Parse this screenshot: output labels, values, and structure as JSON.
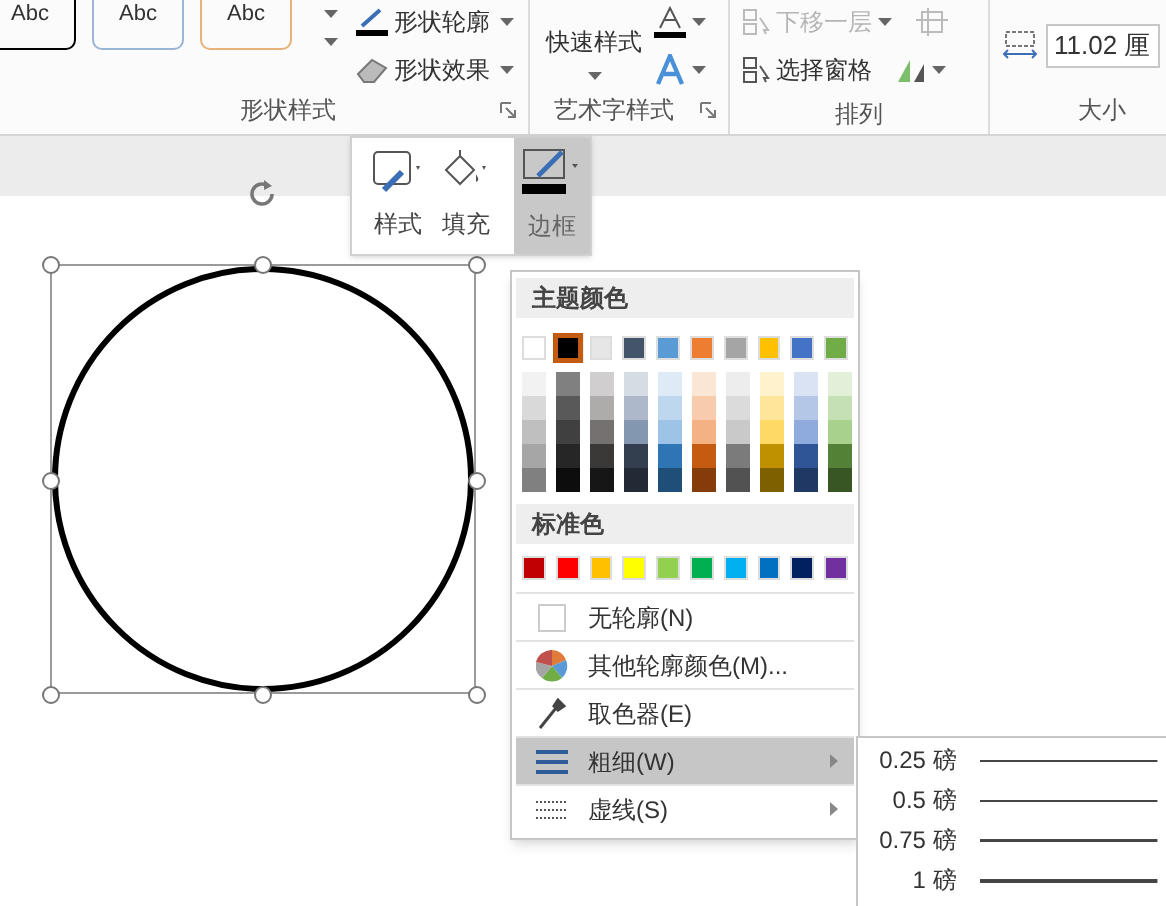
{
  "ribbon": {
    "style_thumbs": [
      "Abc",
      "Abc",
      "Abc"
    ],
    "shape_buttons": [
      {
        "label": "形状轮廓",
        "kind": "outline"
      },
      {
        "label": "形状效果",
        "kind": "effect"
      }
    ],
    "groups": [
      "形状样式",
      "艺术字样式",
      "排列",
      "大小"
    ],
    "quick_style": "快速样式",
    "arrange": [
      {
        "label": "下移一层",
        "disabled": true
      },
      {
        "label": "选择窗格",
        "disabled": false
      }
    ],
    "size_value": "11.02 厘"
  },
  "mini_toolbar": [
    {
      "label": "样式",
      "selected": false
    },
    {
      "label": "填充",
      "selected": false
    },
    {
      "label": "边框",
      "selected": true
    }
  ],
  "menu": {
    "theme_header": "主题颜色",
    "theme_colors": [
      {
        "color": "#ffffff",
        "selected": false,
        "shades": [
          {
            "color": "#f2f2f2"
          },
          {
            "color": "#d9d9d9"
          },
          {
            "color": "#bfbfbf"
          },
          {
            "color": "#a6a6a6"
          },
          {
            "color": "#808080"
          }
        ]
      },
      {
        "color": "#000000",
        "selected": true,
        "shades": [
          {
            "color": "#808080"
          },
          {
            "color": "#595959"
          },
          {
            "color": "#404040"
          },
          {
            "color": "#262626"
          },
          {
            "color": "#0d0d0d"
          }
        ]
      },
      {
        "color": "#e7e6e6",
        "selected": false,
        "shades": [
          {
            "color": "#d0cece"
          },
          {
            "color": "#aeabab"
          },
          {
            "color": "#757171"
          },
          {
            "color": "#3b3838"
          },
          {
            "color": "#171616"
          }
        ]
      },
      {
        "color": "#44546a",
        "selected": false,
        "shades": [
          {
            "color": "#d6dce4"
          },
          {
            "color": "#adb9ca"
          },
          {
            "color": "#8497b0"
          },
          {
            "color": "#333f4f"
          },
          {
            "color": "#222a35"
          }
        ]
      },
      {
        "color": "#5b9bd5",
        "selected": false,
        "shades": [
          {
            "color": "#deebf6"
          },
          {
            "color": "#bdd7ee"
          },
          {
            "color": "#9dc3e6"
          },
          {
            "color": "#2e75b5"
          },
          {
            "color": "#1f4e79"
          }
        ]
      },
      {
        "color": "#ed7d31",
        "selected": false,
        "shades": [
          {
            "color": "#fbe5d5"
          },
          {
            "color": "#f8cbad"
          },
          {
            "color": "#f4b183"
          },
          {
            "color": "#c55a11"
          },
          {
            "color": "#843c0b"
          }
        ]
      },
      {
        "color": "#a5a5a5",
        "selected": false,
        "shades": [
          {
            "color": "#ededed"
          },
          {
            "color": "#dbdbdb"
          },
          {
            "color": "#c9c9c9"
          },
          {
            "color": "#7b7b7b"
          },
          {
            "color": "#525252"
          }
        ]
      },
      {
        "color": "#ffc000",
        "selected": false,
        "shades": [
          {
            "color": "#fff2cc"
          },
          {
            "color": "#fee599"
          },
          {
            "color": "#ffd966"
          },
          {
            "color": "#bf9000"
          },
          {
            "color": "#7f6000"
          }
        ]
      },
      {
        "color": "#4472c4",
        "selected": false,
        "shades": [
          {
            "color": "#dae3f3"
          },
          {
            "color": "#b4c7e7"
          },
          {
            "color": "#8faadc"
          },
          {
            "color": "#2f5597"
          },
          {
            "color": "#203864"
          }
        ]
      },
      {
        "color": "#70ad47",
        "selected": false,
        "shades": [
          {
            "color": "#e2efd9"
          },
          {
            "color": "#c5e0b4"
          },
          {
            "color": "#a9d18e"
          },
          {
            "color": "#538135"
          },
          {
            "color": "#375623"
          }
        ]
      }
    ],
    "standard_header": "标准色",
    "standard_colors": [
      {
        "color": "#c00000",
        "selected": false
      },
      {
        "color": "#ff0000",
        "selected": false
      },
      {
        "color": "#ffc000",
        "selected": false
      },
      {
        "color": "#ffff00",
        "selected": false
      },
      {
        "color": "#92d050",
        "selected": false
      },
      {
        "color": "#00b050",
        "selected": false
      },
      {
        "color": "#00b0f0",
        "selected": false
      },
      {
        "color": "#0070c0",
        "selected": false
      },
      {
        "color": "#002060",
        "selected": false
      },
      {
        "color": "#7030a0",
        "selected": false
      }
    ],
    "items": [
      {
        "label": "无轮廓(N)",
        "kind": "none",
        "selected": false
      },
      {
        "label": "其他轮廓颜色(M)...",
        "kind": "more",
        "selected": false
      },
      {
        "label": "取色器(E)",
        "kind": "eyedropper",
        "selected": false
      },
      {
        "label": "粗细(W)",
        "kind": "weight",
        "selected": true
      },
      {
        "label": "虚线(S)",
        "kind": "dash",
        "selected": false
      }
    ]
  },
  "weights": [
    "0.25 磅",
    "0.5 磅",
    "0.75 磅",
    "1 磅"
  ]
}
